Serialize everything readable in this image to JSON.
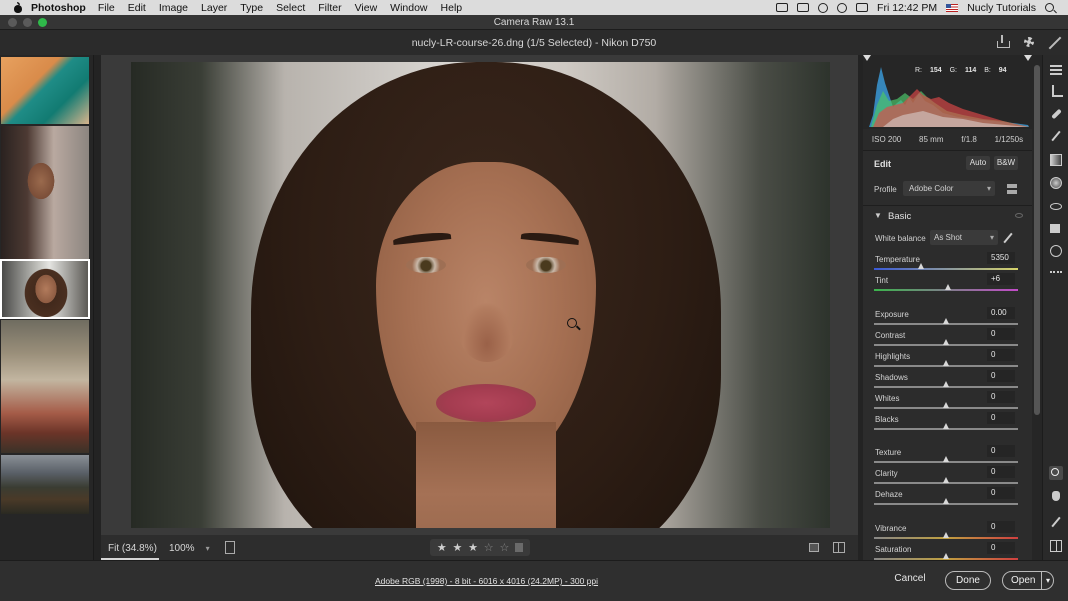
{
  "menubar": {
    "app": "Photoshop",
    "items": [
      "File",
      "Edit",
      "Image",
      "Layer",
      "Type",
      "Select",
      "Filter",
      "View",
      "Window",
      "Help"
    ],
    "clock": "Fri 12:42 PM",
    "user": "Nucly Tutorials"
  },
  "window": {
    "title": "Camera Raw 13.1",
    "document": "nucly-LR-course-26.dng (1/5 Selected)  -  Nikon D750"
  },
  "histogram": {
    "r_label": "R:",
    "r": "154",
    "g_label": "G:",
    "g": "114",
    "b_label": "B:",
    "b": "94"
  },
  "exif": {
    "iso": "ISO 200",
    "focal": "85 mm",
    "aperture": "f/1.8",
    "shutter": "1/1250s"
  },
  "edit": {
    "title": "Edit",
    "auto": "Auto",
    "bw": "B&W",
    "profile_label": "Profile",
    "profile_value": "Adobe Color",
    "section": "Basic",
    "wb_label": "White balance",
    "wb_value": "As Shot"
  },
  "sliders": [
    {
      "label": "Temperature",
      "value": "5350",
      "pos": 0.33,
      "track": "temp"
    },
    {
      "label": "Tint",
      "value": "+6",
      "pos": 0.52,
      "track": "tint"
    },
    {
      "label": "Exposure",
      "value": "0.00",
      "pos": 0.5,
      "track": ""
    },
    {
      "label": "Contrast",
      "value": "0",
      "pos": 0.5,
      "track": ""
    },
    {
      "label": "Highlights",
      "value": "0",
      "pos": 0.5,
      "track": ""
    },
    {
      "label": "Shadows",
      "value": "0",
      "pos": 0.5,
      "track": ""
    },
    {
      "label": "Whites",
      "value": "0",
      "pos": 0.5,
      "track": ""
    },
    {
      "label": "Blacks",
      "value": "0",
      "pos": 0.5,
      "track": ""
    },
    {
      "label": "Texture",
      "value": "0",
      "pos": 0.5,
      "track": ""
    },
    {
      "label": "Clarity",
      "value": "0",
      "pos": 0.5,
      "track": ""
    },
    {
      "label": "Dehaze",
      "value": "0",
      "pos": 0.5,
      "track": ""
    },
    {
      "label": "Vibrance",
      "value": "0",
      "pos": 0.5,
      "track": "vib"
    },
    {
      "label": "Saturation",
      "value": "0",
      "pos": 0.5,
      "track": "sat"
    }
  ],
  "canvas": {
    "fit": "Fit (34.8%)",
    "zoom": "100%",
    "rating_stars": 3,
    "rating_max": 5
  },
  "footer": {
    "info": "Adobe RGB (1998) - 8 bit - 6016 x 4016 (24.2MP) - 300 ppi",
    "cancel": "Cancel",
    "done": "Done",
    "open": "Open"
  }
}
